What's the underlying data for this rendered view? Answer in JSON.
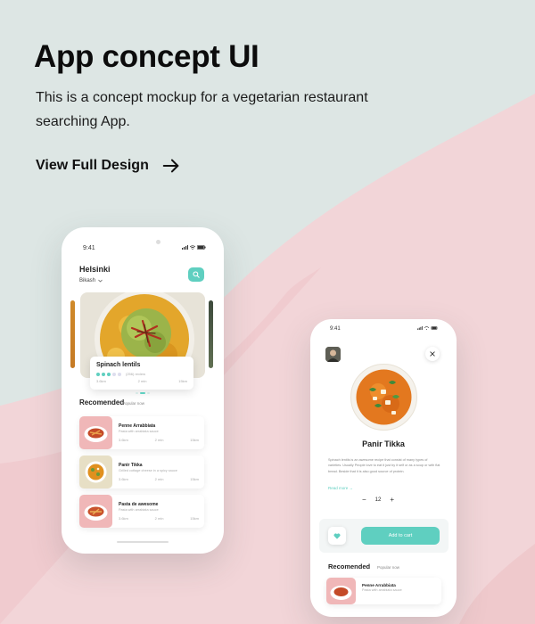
{
  "hero": {
    "title": "App concept UI",
    "description": "This is a concept mockup for a vegetarian restaurant searching App.",
    "cta_label": "View Full Design"
  },
  "colors": {
    "background": "#dde6e4",
    "pink_wave": "#f2d3d6",
    "accent": "#5fcfc0",
    "text": "#111111"
  },
  "phone1": {
    "time": "9:41",
    "city": "Helsinki",
    "district": "Bikash",
    "featured": {
      "name": "Spinach lentils",
      "reviews": "(256) review",
      "meta": [
        "3.6km",
        "2 min",
        "15km"
      ],
      "rating": 3,
      "rating_max": 5
    },
    "section_title": "Recomended",
    "section_link": "Popular now",
    "items": [
      {
        "name": "Penne Arrabbiata",
        "sub": "Pasta with arrabiata sauce",
        "meta": [
          "3.6km",
          "2 min",
          "15km"
        ]
      },
      {
        "name": "Panir Tikka",
        "sub": "Grilled cottage cheese in a spicy sauce",
        "meta": [
          "3.6km",
          "2 min",
          "15km"
        ]
      },
      {
        "name": "Pasta de awesome",
        "sub": "Pasta with arrabiata sauce",
        "meta": [
          "3.6km",
          "2 min",
          "15km"
        ]
      }
    ]
  },
  "phone2": {
    "time": "9:41",
    "dish_name": "Panir Tikka",
    "description": "Spinach lentils is an awesome recipe that consist of many types of varieties. Usually People love to eat it just by it self or as a soup or with flat bread. Beside that it is also good source of protein.",
    "read_more": "Read more →",
    "qty_minus": "−",
    "qty_value": "12",
    "qty_plus": "+",
    "add_to_cart": "Add to cart",
    "section_title": "Recomended",
    "section_link": "Popular now",
    "item": {
      "name": "Penne Arrabbiata",
      "sub": "Pasta with arrabiata sauce"
    }
  }
}
